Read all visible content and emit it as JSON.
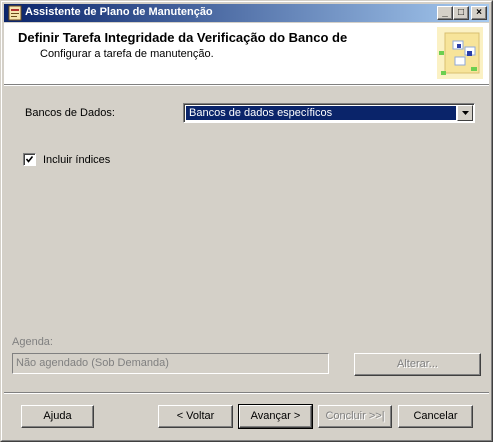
{
  "window": {
    "title": "Assistente de Plano de Manutenção"
  },
  "titlebar_buttons": {
    "minimize": "_",
    "maximize": "□",
    "close": "×"
  },
  "header": {
    "title": "Definir Tarefa Integridade da Verificação do Banco de",
    "subtitle": "Configurar a tarefa de manutenção."
  },
  "databases": {
    "label": "Bancos de Dados:",
    "selected": "Bancos de dados específicos"
  },
  "include_indexes": {
    "label": "Incluir índices",
    "checked": true
  },
  "schedule": {
    "label": "Agenda:",
    "value": "Não agendado (Sob Demanda)",
    "change_button": "Alterar..."
  },
  "footer": {
    "help": "Ajuda",
    "back": "< Voltar",
    "next": "Avançar >",
    "finish": "Concluir >>|",
    "cancel": "Cancelar"
  },
  "colors": {
    "titlebar_start": "#0a246a",
    "titlebar_end": "#a6caf0",
    "selection": "#0a246a",
    "face": "#d4d0c8"
  }
}
